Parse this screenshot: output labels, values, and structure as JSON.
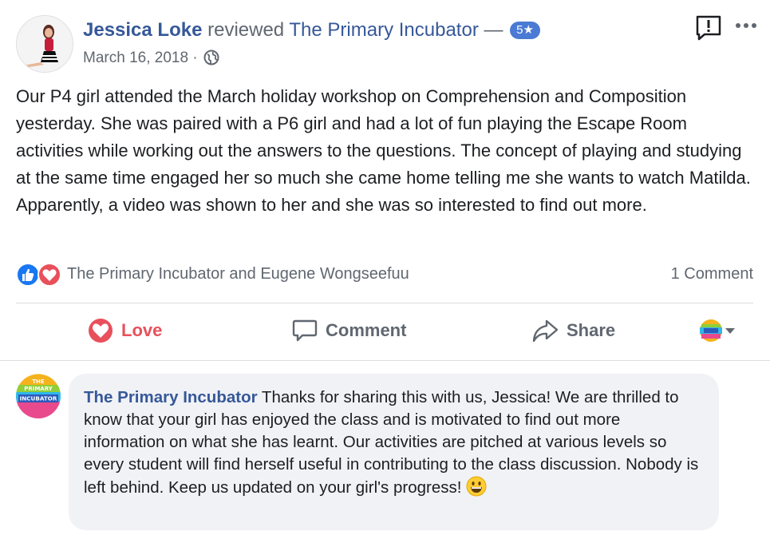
{
  "post": {
    "author": "Jessica Loke",
    "verb": "reviewed",
    "page": "The Primary Incubator",
    "dash": "—",
    "rating": "5★",
    "date": "March 16, 2018",
    "separator": "·",
    "privacy_icon": "globe-icon",
    "body": "Our P4 girl attended the March holiday workshop on Comprehension and Composition yesterday. She was paired with a P6 girl and had a lot of fun playing the Escape Room activities while working out the answers to the questions. The concept of playing and studying at the same time engaged her so much she came home telling me she wants to watch Matilda. Apparently, a video was shown to her and she was so interested to find out more.",
    "reactions": {
      "icons": [
        "like-icon",
        "love-icon"
      ],
      "names": "The Primary Incubator and Eugene Wongseefuu",
      "comment_count": "1 Comment"
    }
  },
  "actions": {
    "love_label": "Love",
    "comment_label": "Comment",
    "share_label": "Share"
  },
  "logo": {
    "line1": "THE",
    "line2": "PRIMARY",
    "line3": "INCUBATOR"
  },
  "comment": {
    "author": "The Primary Incubator",
    "text": "Thanks for sharing this with us, Jessica! We are thrilled to know that your girl has enjoyed the class and is motivated to find out more information on what she has learnt. Our activities are pitched at various levels so every student will find herself useful in contributing to the class discussion. Nobody is left behind. Keep us updated on your girl's progress!",
    "emoji": "grinning-face-emoji"
  },
  "colors": {
    "link": "#365899",
    "love": "#e8505b",
    "like": "#1877f2",
    "badge": "#4a7ad4",
    "muted": "#606770",
    "bubble": "#f0f2f5"
  }
}
